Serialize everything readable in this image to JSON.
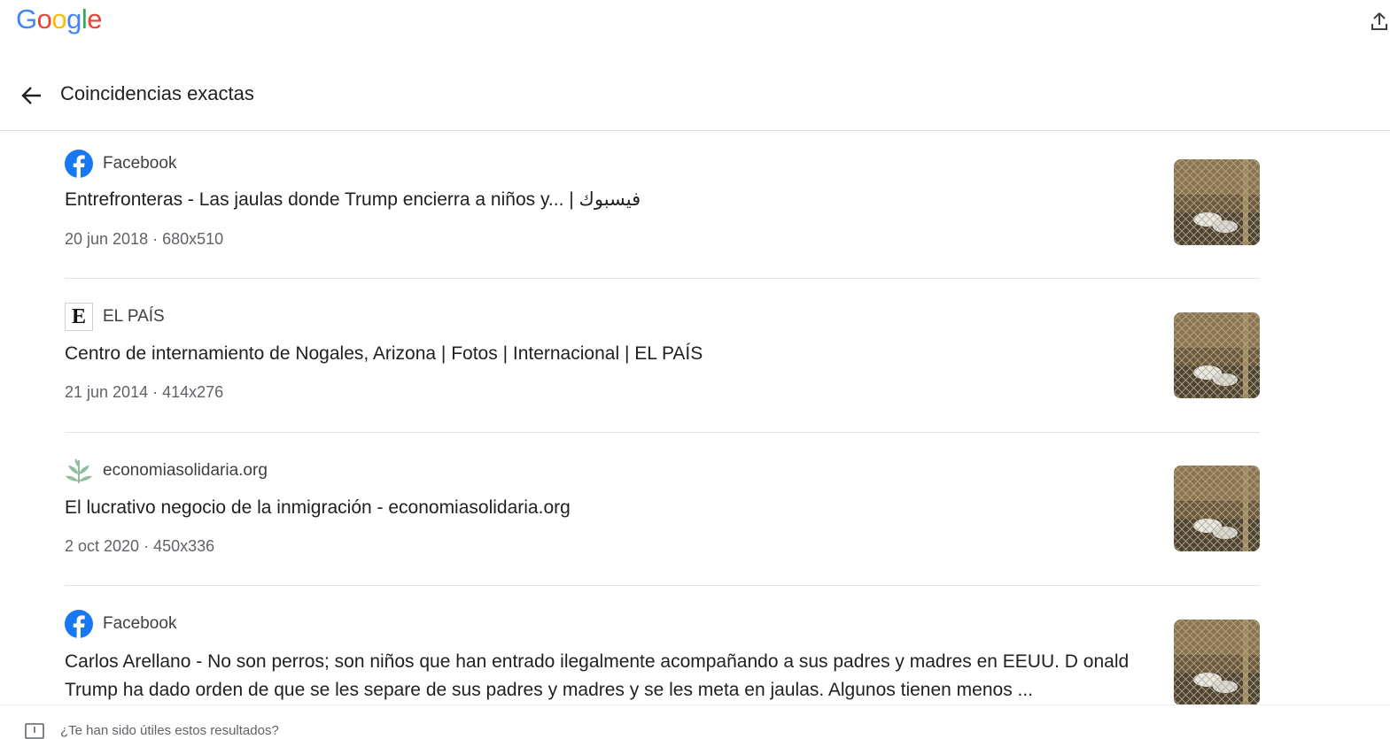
{
  "brand": {
    "logo_letters": [
      "G",
      "o",
      "o",
      "g",
      "l",
      "e"
    ]
  },
  "header": {
    "title": "Coincidencias exactas"
  },
  "results": [
    {
      "source": "Facebook",
      "favicon": "facebook-icon",
      "title": "Entrefronteras - Las jaulas donde Trump encierra a niños y... | فيسبوك",
      "date": "20 jun 2018",
      "dimensions": "680x510"
    },
    {
      "source": "EL PAÍS",
      "favicon": "elpais-icon",
      "favicon_text": "E",
      "title": "Centro de internamiento de Nogales, Arizona | Fotos | Internacional | EL PAÍS",
      "date": "21 jun 2014",
      "dimensions": "414x276"
    },
    {
      "source": "economiasolidaria.org",
      "favicon": "leaf-icon",
      "title": "El lucrativo negocio de la inmigración - economiasolidaria.org",
      "date": "2 oct 2020",
      "dimensions": "450x336"
    },
    {
      "source": "Facebook",
      "favicon": "facebook-icon",
      "title": "Carlos Arellano - No son perros; son niños que han entrado ilegalmente acompañando a sus padres y madres en EEUU. D onald Trump ha dado orden de que se les separe de sus padres y madres y se les meta en jaulas. Algunos tienen menos ...",
      "date": "",
      "dimensions": ""
    }
  ],
  "footer": {
    "text": "¿Te han sido útiles estos resultados?",
    "icon": "feedback-icon"
  },
  "colors": {
    "facebook_blue": "#1877F2",
    "leaf_green": "#8fbf9f",
    "divider": "#e3e3e3"
  }
}
